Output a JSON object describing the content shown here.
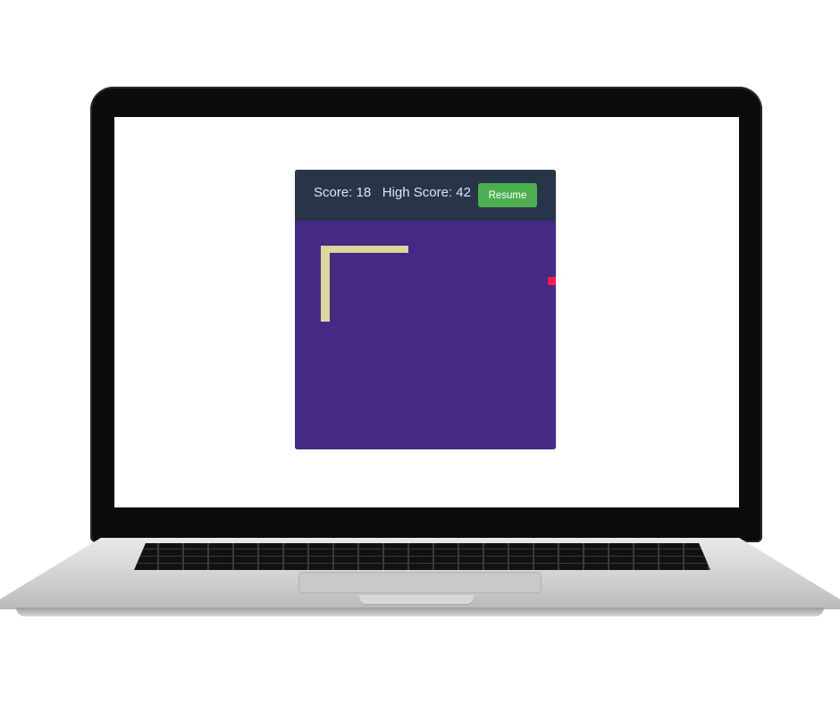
{
  "header": {
    "score_label": "Score:",
    "score": "18",
    "high_score_label": "High Score:",
    "high_score": "42",
    "resume_label": "Resume"
  },
  "colors": {
    "header_bg": "#283447",
    "board_bg": "#442a84",
    "snake": "#d9d79a",
    "food": "#ff1a40",
    "button": "#4caf50"
  },
  "icons": {
    "snake": "snake-body",
    "food": "food-pellet"
  }
}
